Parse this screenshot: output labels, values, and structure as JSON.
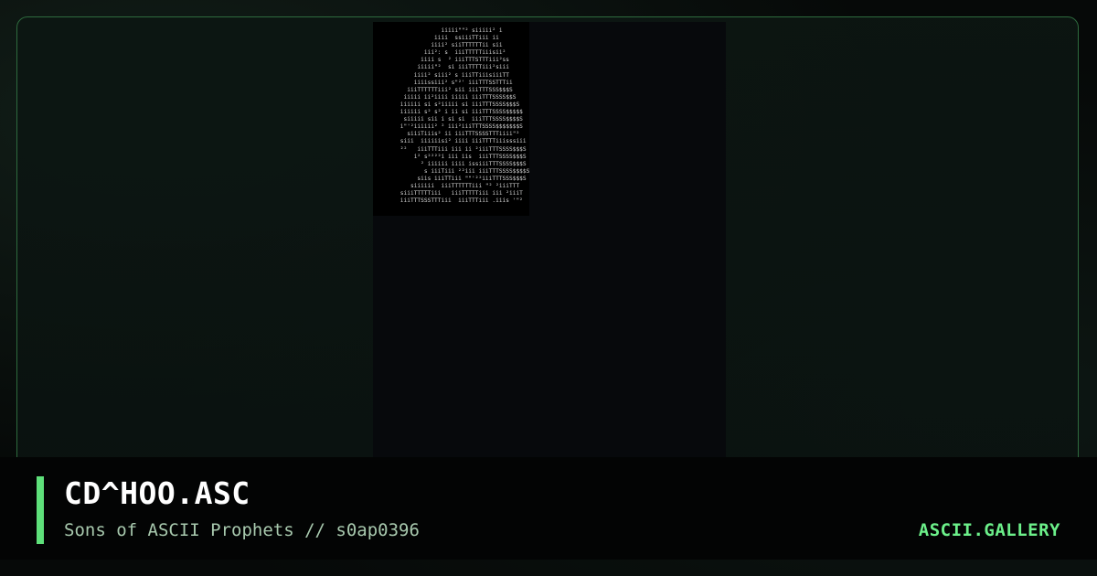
{
  "artwork": {
    "lines": [
      "                    iiiii\"\"² siiiii² i",
      "                  iiii  ssiiiTTiii ii",
      "                 iiii² siiTTTTTTii sii",
      "               iii²: s  iiiTTTTTiiisii²",
      "              iiii s  ² iiiTTTSTTTiii²ss",
      "             iiiii\"²  si iiiTTTTiii²siii",
      "            iiii² siii² s iiiTTiiisiiiTT",
      "            iiiissiii² s\"²' iiiTTTSSTTTii",
      "          iiiTTTTTTiii² sii iiiTTTSSS$$$S",
      "         iiiii ii²iiii iiiii iiiTTTSSSS$$S",
      "        iiiiii si s²iiiii si iiiTTTSSSS$$$S",
      "        iiiiii s² s² i ii si iiiTTTSSSS$$$$$",
      "         siiiii sii i si si  iiiTTTSSSS$$$$S",
      "        i\"'²iiiiii² ² iii²iiiTTTSSSS$$$$$$$S",
      "          siiiTiiis² ii iiiTTTSSSSTTTiiii\"²",
      "        siii  iiiiiisi² iiii iiiTTTTiiisssiii",
      "        ²²   iiiTTTiii iii ii ²iiiTTTSSSS$$$S",
      "            i² s²²²²i iii iis  iiiTTTSSSS$$$S",
      "              ² iiiiii iiii issiiiTTTSSSS$$$S",
      "               s iiiTiii ²²iii iiiTTTSSSS$$$$S",
      "             siis iiiTTiii \"\"'²²iiiTTTSSS$$$S",
      "           siiiiii  iiiTTTTTTiii \"² ²iiiTTT",
      "        siiiTTTTTiii   iiiTTTTTiii iii ²iiiT",
      "        iiiTTTSSSTTTiii  iiiTTTiii .iiis '\"²"
    ]
  },
  "footer": {
    "title": "CD^HOO.ASC",
    "subtitle": "Sons of ASCII Prophets // s0ap0396",
    "brand": "ASCII.GALLERY"
  },
  "colors": {
    "accent": "#5ee07a",
    "brand": "#6cf08a",
    "frame_border": "#2e6b3e",
    "subtitle": "#a8c9ae"
  }
}
